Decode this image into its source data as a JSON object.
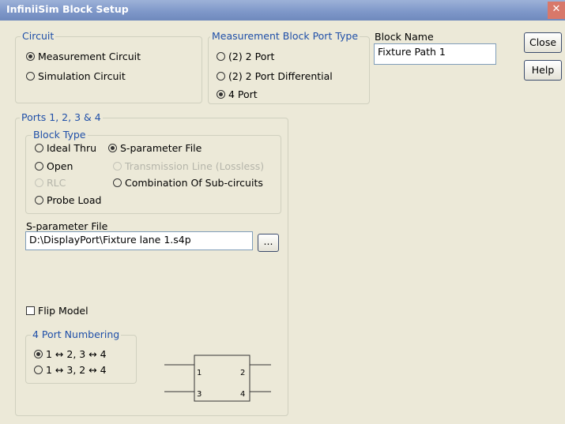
{
  "window": {
    "title": "InfiniiSim Block Setup",
    "close_glyph": "✕"
  },
  "circuit": {
    "legend": "Circuit",
    "options": [
      "Measurement Circuit",
      "Simulation Circuit"
    ],
    "selected": 0
  },
  "port_type": {
    "legend": "Measurement Block Port Type",
    "options": [
      "(2) 2 Port",
      "(2) 2 Port Differential",
      "4 Port"
    ],
    "selected": 2
  },
  "block_name": {
    "label": "Block Name",
    "value": "Fixture Path 1"
  },
  "buttons": {
    "close": "Close",
    "help": "Help"
  },
  "ports": {
    "legend": "Ports 1, 2, 3 & 4",
    "block_type": {
      "legend": "Block Type",
      "options": {
        "ideal_thru": "Ideal Thru",
        "sparam_file": "S-parameter File",
        "open": "Open",
        "transmission_line": "Transmission Line (Lossless)",
        "rlc": "RLC",
        "combination": "Combination Of Sub-circuits",
        "probe_load": "Probe Load"
      },
      "selected": "sparam_file",
      "disabled": [
        "transmission_line",
        "rlc"
      ]
    },
    "sparam": {
      "label": "S-parameter File",
      "value": "D:\\DisplayPort\\Fixture lane 1.s4p",
      "browse": "..."
    },
    "flip_model": {
      "label": "Flip Model",
      "checked": false
    },
    "numbering": {
      "legend": "4 Port Numbering",
      "options": [
        "1 ↔ 2, 3 ↔ 4",
        "1 ↔ 3, 2 ↔ 4"
      ],
      "selected": 0
    },
    "diagram": {
      "p1": "1",
      "p2": "2",
      "p3": "3",
      "p4": "4"
    }
  }
}
